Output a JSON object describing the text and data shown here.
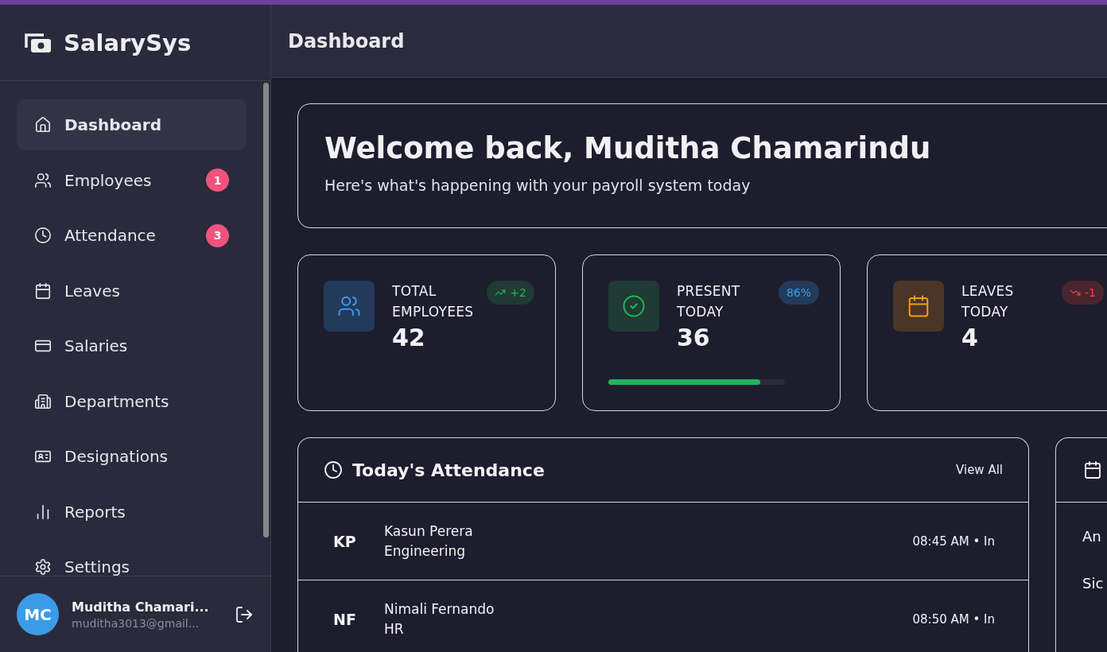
{
  "brand": {
    "name": "SalarySys"
  },
  "nav": [
    {
      "label": "Dashboard",
      "selected": true
    },
    {
      "label": "Employees",
      "selected": false,
      "badge": "1"
    },
    {
      "label": "Attendance",
      "selected": false,
      "badge": "3"
    },
    {
      "label": "Leaves",
      "selected": false
    },
    {
      "label": "Salaries",
      "selected": false
    },
    {
      "label": "Departments",
      "selected": false
    },
    {
      "label": "Designations",
      "selected": false
    },
    {
      "label": "Reports",
      "selected": false
    },
    {
      "label": "Settings",
      "selected": false
    }
  ],
  "user": {
    "initials": "MC",
    "name": "Muditha Chamari...",
    "email": "muditha3013@gmail..."
  },
  "header": {
    "title": "Dashboard"
  },
  "welcome": {
    "title": "Welcome back, Muditha Chamarindu",
    "subtitle": "Here's what's happening with your payroll system today"
  },
  "stats": [
    {
      "label": "TOTAL EMPLOYEES",
      "value": "42",
      "chip": "+2"
    },
    {
      "label": "PRESENT TODAY",
      "value": "36",
      "chip": "86%",
      "level": 0.86
    },
    {
      "label": "LEAVES TODAY",
      "value": "4",
      "chip": "-1"
    }
  ],
  "attendance": {
    "title": "Today's Attendance",
    "action": "View All",
    "rows": [
      {
        "initials": "KP",
        "name": "Kasun Perera",
        "department": "Engineering",
        "time": "08:45 AM • In"
      },
      {
        "initials": "NF",
        "name": "Nimali Fernando",
        "department": "HR",
        "time": "08:50 AM • In"
      }
    ]
  },
  "side_card": {
    "rows": [
      "An",
      "Sic"
    ]
  }
}
